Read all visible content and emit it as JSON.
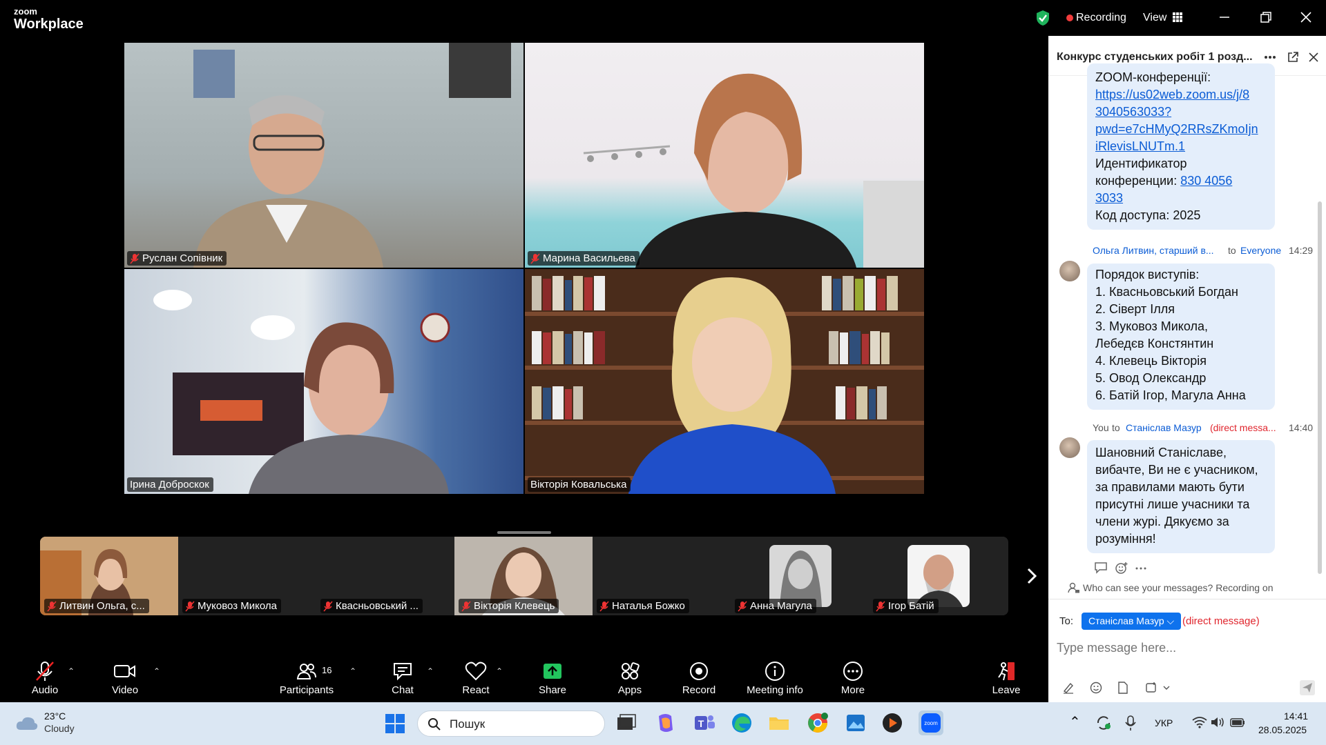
{
  "app": {
    "brand_small": "zoom",
    "brand_big": "Workplace",
    "recording_label": "Recording",
    "view_label": "View"
  },
  "gallery": [
    {
      "name": "Руслан Сопівник",
      "muted": true
    },
    {
      "name": "Марина Васильева",
      "muted": true
    },
    {
      "name": "Ірина Доброскок",
      "muted": false
    },
    {
      "name": "Вікторія Ковальська",
      "muted": false,
      "active_speaker": true
    }
  ],
  "strip": [
    {
      "name": "Литвин Ольга, с...",
      "video": true
    },
    {
      "name": "Муковоз Микола",
      "video": false
    },
    {
      "name": "Квасньовський ...",
      "video": false
    },
    {
      "name": "Вікторія Клевець",
      "video": true
    },
    {
      "name": "Наталья Божко",
      "video": false
    },
    {
      "name": "Анна Магула",
      "video": false
    },
    {
      "name": "Ігор Батій",
      "video": false
    }
  ],
  "toolbar": {
    "audio": "Audio",
    "video": "Video",
    "participants": "Participants",
    "participants_count": "16",
    "chat": "Chat",
    "react": "React",
    "share": "Share",
    "apps": "Apps",
    "record": "Record",
    "meeting_info": "Meeting info",
    "more": "More",
    "leave": "Leave"
  },
  "chat": {
    "title": "Конкурс студенських робіт 1 розд...",
    "msg1": {
      "line1": "ZOOM-конференції:",
      "link": "https://us02web.zoom.us/j/83040563033?pwd=e7cHMyQ2RRsZKmoIjniRlevisLNUTm.1",
      "link_lines": [
        "https://us02web.zoom.us/j/8",
        "3040563033?",
        "pwd=e7cHMyQ2RRsZKmoIjn",
        "iRlevisLNUTm.1"
      ],
      "id_label": "Идентификатор",
      "id_label2": "конференции:",
      "id_value_1": "830 4056",
      "id_value_2": "3033",
      "code": "Код доступа: 2025"
    },
    "msg2": {
      "sender": "Ольга Литвин, старший в...",
      "to": "to",
      "recipient": "Everyone",
      "time": "14:29",
      "lines": [
        "Порядок виступів:",
        "1. Квасньовський Богдан",
        "2. Сіверт Ілля",
        "3. Муковоз Микола,",
        "Лебедєв Констянтин",
        "4. Клевець Вікторія",
        "5. Овод Олександр",
        "6. Батій Ігор, Магула Анна"
      ]
    },
    "msg3": {
      "sender": "You",
      "to": "to",
      "recipient": "Станіслав Мазур",
      "dm_tag": "(direct messa...",
      "time": "14:40",
      "lines": [
        "Шановний Станіславе,",
        "вибачте, Ви не є учасником,",
        "за правилами мають бути",
        "присутні лише учасники та",
        "члени журі. Дякуємо за",
        "розуміння!"
      ]
    },
    "visibility_note": "Who can see your messages? Recording on",
    "to_label": "To:",
    "recipient_dropdown": "Станіслав Мазур",
    "direct_message_tag": "(direct message)",
    "input_placeholder": "Type message here..."
  },
  "taskbar": {
    "temp": "23°C",
    "weather": "Cloudy",
    "search_placeholder": "Пошук",
    "lang": "УКР",
    "time": "14:41",
    "date": "28.05.2025"
  },
  "colors": {
    "accent": "#0e72ed",
    "active_speaker": "#29d39a",
    "record_red": "#f23c3c",
    "share_green": "#22c55e"
  }
}
